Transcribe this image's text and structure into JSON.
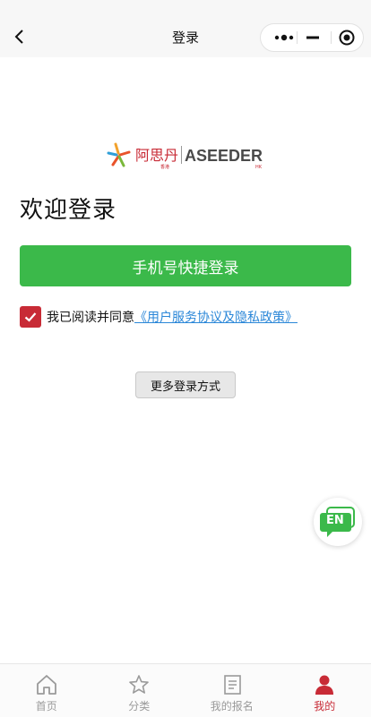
{
  "nav": {
    "title": "登录",
    "back_icon": "chevron-left-icon",
    "capsule": {
      "more_icon": "more-dots-icon",
      "minimize_icon": "minimize-icon",
      "close_icon": "record-circle-icon"
    }
  },
  "logo": {
    "cn": "阿思丹",
    "en": "ASEEDER",
    "cn_sub": "香港",
    "en_sub": "HK"
  },
  "welcome": "欢迎登录",
  "login_button": "手机号快捷登录",
  "agreement": {
    "checked": true,
    "prefix": "我已阅读并同意",
    "link": "《用户服务协议及隐私政策》"
  },
  "more_login": "更多登录方式",
  "lang_float": {
    "label": "EN",
    "icon": "chat-bubble-icon"
  },
  "tabbar": {
    "items": [
      {
        "label": "首页",
        "icon": "home-icon",
        "active": false
      },
      {
        "label": "分类",
        "icon": "star-icon",
        "active": false
      },
      {
        "label": "我的报名",
        "icon": "document-icon",
        "active": false
      },
      {
        "label": "我的",
        "icon": "user-icon",
        "active": true
      }
    ]
  },
  "colors": {
    "primary_green": "#3bb94a",
    "accent_red": "#c82b36",
    "link_blue": "#2b87d8",
    "tab_inactive": "#9a9a9a"
  }
}
